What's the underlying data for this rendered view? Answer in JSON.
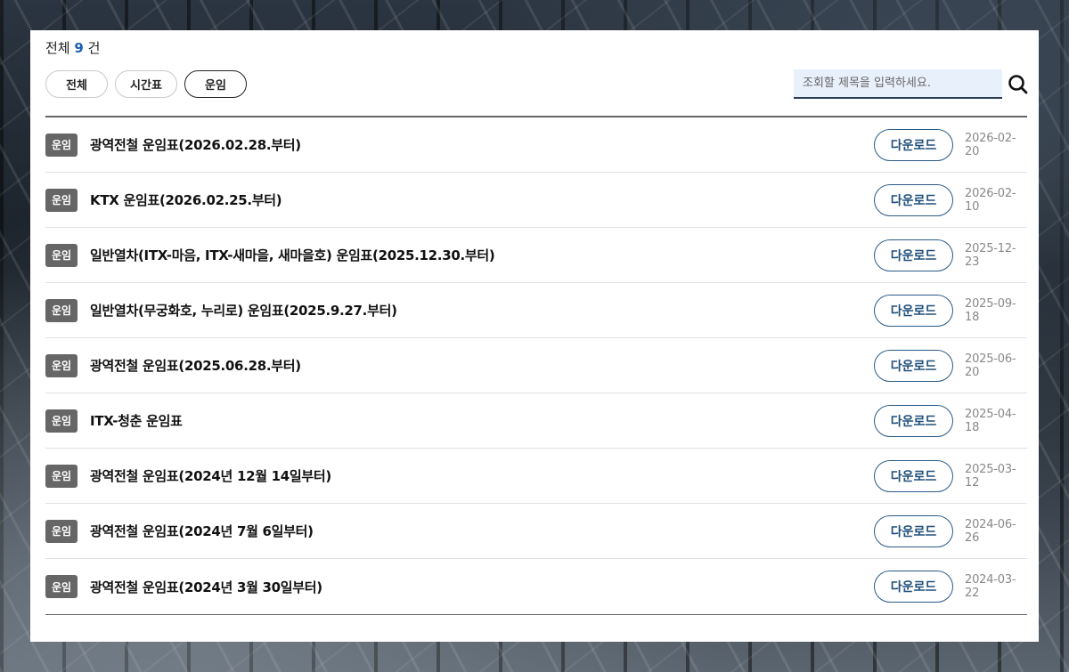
{
  "summary": {
    "prefix": "전체",
    "count": "9",
    "suffix": "건"
  },
  "filters": {
    "all": "전체",
    "timetable": "시간표",
    "fare": "운임"
  },
  "search": {
    "placeholder": "조회할 제목을 입력하세요."
  },
  "rows": [
    {
      "badge": "운임",
      "title": "광역전철 운임표(2026.02.28.부터)",
      "button": "다운로드",
      "date": "2026-02-20"
    },
    {
      "badge": "운임",
      "title": "KTX 운임표(2026.02.25.부터)",
      "button": "다운로드",
      "date": "2026-02-10"
    },
    {
      "badge": "운임",
      "title": "일반열차(ITX-마음, ITX-새마을, 새마을호) 운임표(2025.12.30.부터)",
      "button": "다운로드",
      "date": "2025-12-23"
    },
    {
      "badge": "운임",
      "title": "일반열차(무궁화호, 누리로) 운임표(2025.9.27.부터)",
      "button": "다운로드",
      "date": "2025-09-18"
    },
    {
      "badge": "운임",
      "title": "광역전철 운임표(2025.06.28.부터)",
      "button": "다운로드",
      "date": "2025-06-20"
    },
    {
      "badge": "운임",
      "title": "ITX-청춘 운임표",
      "button": "다운로드",
      "date": "2025-04-18"
    },
    {
      "badge": "운임",
      "title": "광역전철 운임표(2024년 12월 14일부터)",
      "button": "다운로드",
      "date": "2025-03-12"
    },
    {
      "badge": "운임",
      "title": "광역전철 운임표(2024년 7월 6일부터)",
      "button": "다운로드",
      "date": "2024-06-26"
    },
    {
      "badge": "운임",
      "title": "광역전철 운임표(2024년 3월 30일부터)",
      "button": "다운로드",
      "date": "2024-03-22"
    }
  ]
}
